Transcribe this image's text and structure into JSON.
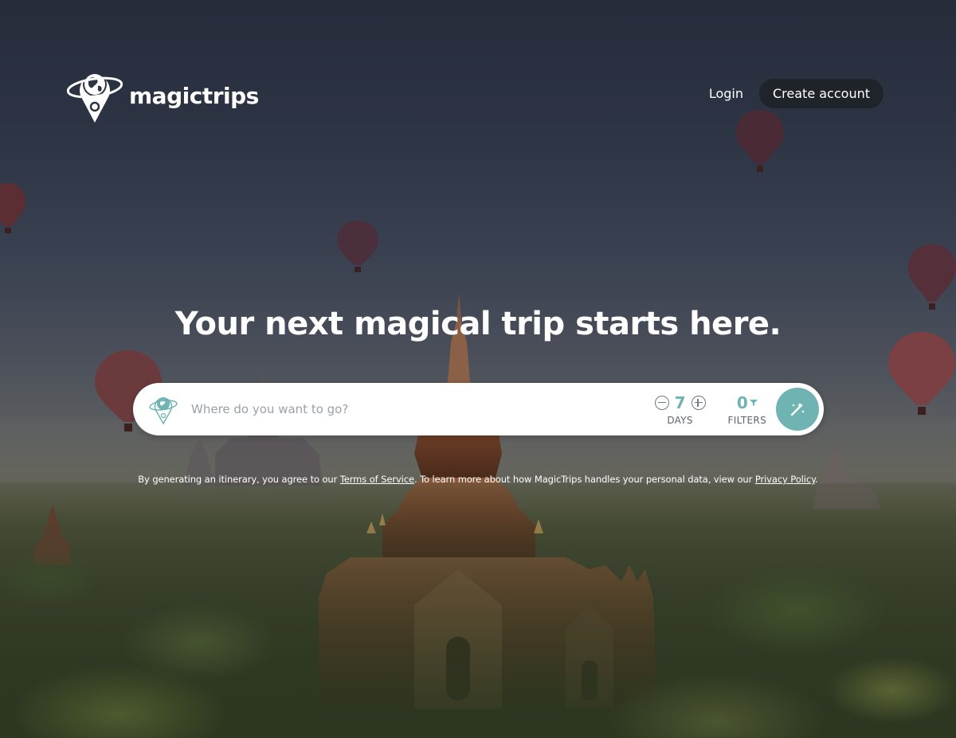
{
  "brand": {
    "name": "magictrips"
  },
  "nav": {
    "login_label": "Login",
    "create_account_label": "Create account"
  },
  "hero": {
    "headline": "Your next magical trip starts here."
  },
  "search": {
    "placeholder": "Where do you want to go?",
    "days_value": "7",
    "days_label": "DAYS",
    "filters_value": "0",
    "filters_label": "FILTERS"
  },
  "disclaimer": {
    "prefix": "By generating an itinerary, you agree to our ",
    "terms_link": "Terms of Service",
    "middle": ". To learn more about how MagicTrips handles your personal data, view our ",
    "privacy_link": "Privacy Policy",
    "suffix": "."
  },
  "colors": {
    "accent": "#6fb4b2",
    "button_dark": "#1f242b"
  },
  "icons": {
    "logo": "globe-pin-icon",
    "search": "globe-pin-icon",
    "go": "magic-wand-icon",
    "filter": "filter-funnel-icon",
    "minus": "minus-circle-icon",
    "plus": "plus-circle-icon"
  }
}
